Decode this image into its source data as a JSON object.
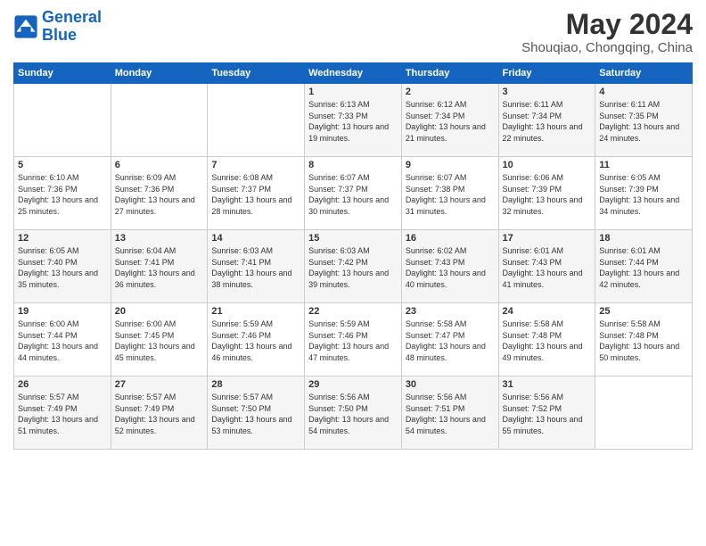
{
  "logo": {
    "line1": "General",
    "line2": "Blue"
  },
  "title": "May 2024",
  "subtitle": "Shouqiao, Chongqing, China",
  "days_of_week": [
    "Sunday",
    "Monday",
    "Tuesday",
    "Wednesday",
    "Thursday",
    "Friday",
    "Saturday"
  ],
  "weeks": [
    [
      {
        "day": "",
        "info": ""
      },
      {
        "day": "",
        "info": ""
      },
      {
        "day": "",
        "info": ""
      },
      {
        "day": "1",
        "info": "Sunrise: 6:13 AM\nSunset: 7:33 PM\nDaylight: 13 hours\nand 19 minutes."
      },
      {
        "day": "2",
        "info": "Sunrise: 6:12 AM\nSunset: 7:34 PM\nDaylight: 13 hours\nand 21 minutes."
      },
      {
        "day": "3",
        "info": "Sunrise: 6:11 AM\nSunset: 7:34 PM\nDaylight: 13 hours\nand 22 minutes."
      },
      {
        "day": "4",
        "info": "Sunrise: 6:11 AM\nSunset: 7:35 PM\nDaylight: 13 hours\nand 24 minutes."
      }
    ],
    [
      {
        "day": "5",
        "info": "Sunrise: 6:10 AM\nSunset: 7:36 PM\nDaylight: 13 hours\nand 25 minutes."
      },
      {
        "day": "6",
        "info": "Sunrise: 6:09 AM\nSunset: 7:36 PM\nDaylight: 13 hours\nand 27 minutes."
      },
      {
        "day": "7",
        "info": "Sunrise: 6:08 AM\nSunset: 7:37 PM\nDaylight: 13 hours\nand 28 minutes."
      },
      {
        "day": "8",
        "info": "Sunrise: 6:07 AM\nSunset: 7:37 PM\nDaylight: 13 hours\nand 30 minutes."
      },
      {
        "day": "9",
        "info": "Sunrise: 6:07 AM\nSunset: 7:38 PM\nDaylight: 13 hours\nand 31 minutes."
      },
      {
        "day": "10",
        "info": "Sunrise: 6:06 AM\nSunset: 7:39 PM\nDaylight: 13 hours\nand 32 minutes."
      },
      {
        "day": "11",
        "info": "Sunrise: 6:05 AM\nSunset: 7:39 PM\nDaylight: 13 hours\nand 34 minutes."
      }
    ],
    [
      {
        "day": "12",
        "info": "Sunrise: 6:05 AM\nSunset: 7:40 PM\nDaylight: 13 hours\nand 35 minutes."
      },
      {
        "day": "13",
        "info": "Sunrise: 6:04 AM\nSunset: 7:41 PM\nDaylight: 13 hours\nand 36 minutes."
      },
      {
        "day": "14",
        "info": "Sunrise: 6:03 AM\nSunset: 7:41 PM\nDaylight: 13 hours\nand 38 minutes."
      },
      {
        "day": "15",
        "info": "Sunrise: 6:03 AM\nSunset: 7:42 PM\nDaylight: 13 hours\nand 39 minutes."
      },
      {
        "day": "16",
        "info": "Sunrise: 6:02 AM\nSunset: 7:43 PM\nDaylight: 13 hours\nand 40 minutes."
      },
      {
        "day": "17",
        "info": "Sunrise: 6:01 AM\nSunset: 7:43 PM\nDaylight: 13 hours\nand 41 minutes."
      },
      {
        "day": "18",
        "info": "Sunrise: 6:01 AM\nSunset: 7:44 PM\nDaylight: 13 hours\nand 42 minutes."
      }
    ],
    [
      {
        "day": "19",
        "info": "Sunrise: 6:00 AM\nSunset: 7:44 PM\nDaylight: 13 hours\nand 44 minutes."
      },
      {
        "day": "20",
        "info": "Sunrise: 6:00 AM\nSunset: 7:45 PM\nDaylight: 13 hours\nand 45 minutes."
      },
      {
        "day": "21",
        "info": "Sunrise: 5:59 AM\nSunset: 7:46 PM\nDaylight: 13 hours\nand 46 minutes."
      },
      {
        "day": "22",
        "info": "Sunrise: 5:59 AM\nSunset: 7:46 PM\nDaylight: 13 hours\nand 47 minutes."
      },
      {
        "day": "23",
        "info": "Sunrise: 5:58 AM\nSunset: 7:47 PM\nDaylight: 13 hours\nand 48 minutes."
      },
      {
        "day": "24",
        "info": "Sunrise: 5:58 AM\nSunset: 7:48 PM\nDaylight: 13 hours\nand 49 minutes."
      },
      {
        "day": "25",
        "info": "Sunrise: 5:58 AM\nSunset: 7:48 PM\nDaylight: 13 hours\nand 50 minutes."
      }
    ],
    [
      {
        "day": "26",
        "info": "Sunrise: 5:57 AM\nSunset: 7:49 PM\nDaylight: 13 hours\nand 51 minutes."
      },
      {
        "day": "27",
        "info": "Sunrise: 5:57 AM\nSunset: 7:49 PM\nDaylight: 13 hours\nand 52 minutes."
      },
      {
        "day": "28",
        "info": "Sunrise: 5:57 AM\nSunset: 7:50 PM\nDaylight: 13 hours\nand 53 minutes."
      },
      {
        "day": "29",
        "info": "Sunrise: 5:56 AM\nSunset: 7:50 PM\nDaylight: 13 hours\nand 54 minutes."
      },
      {
        "day": "30",
        "info": "Sunrise: 5:56 AM\nSunset: 7:51 PM\nDaylight: 13 hours\nand 54 minutes."
      },
      {
        "day": "31",
        "info": "Sunrise: 5:56 AM\nSunset: 7:52 PM\nDaylight: 13 hours\nand 55 minutes."
      },
      {
        "day": "",
        "info": ""
      }
    ]
  ]
}
